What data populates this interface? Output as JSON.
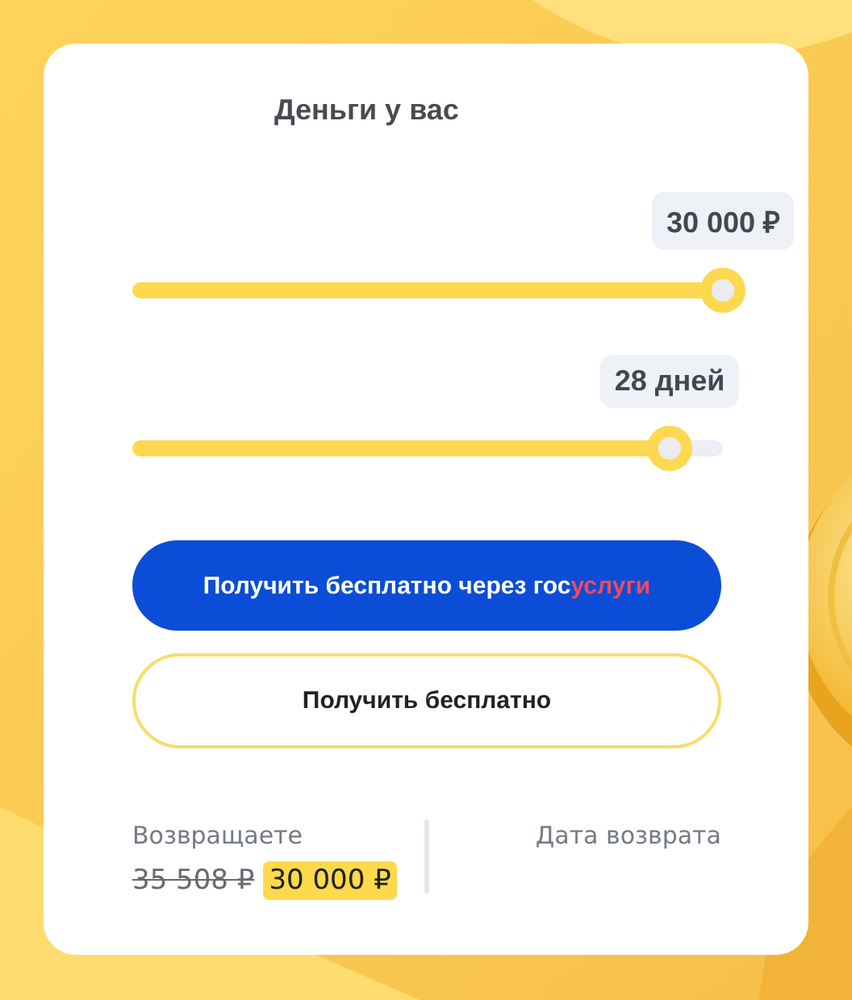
{
  "title": "Деньги у вас",
  "sliders": [
    {
      "reading": "30 000 ₽",
      "level": 1
    },
    {
      "reading": "28 дней",
      "level": 0.91
    }
  ],
  "buttons": [
    {
      "kind": "primary",
      "parts": [
        {
          "text": "Получить бесплатно через гос",
          "kind": "plain"
        },
        {
          "text": "услуги",
          "kind": "accent"
        }
      ]
    },
    {
      "kind": "outline",
      "parts": [
        {
          "text": "Получить бесплатно",
          "kind": "plain"
        }
      ]
    }
  ],
  "repayment": {
    "label": "Возвращаете",
    "old_amount": "35 508 ₽",
    "amount": "30 000 ₽"
  },
  "return_date": {
    "label": "Дата возврата"
  }
}
